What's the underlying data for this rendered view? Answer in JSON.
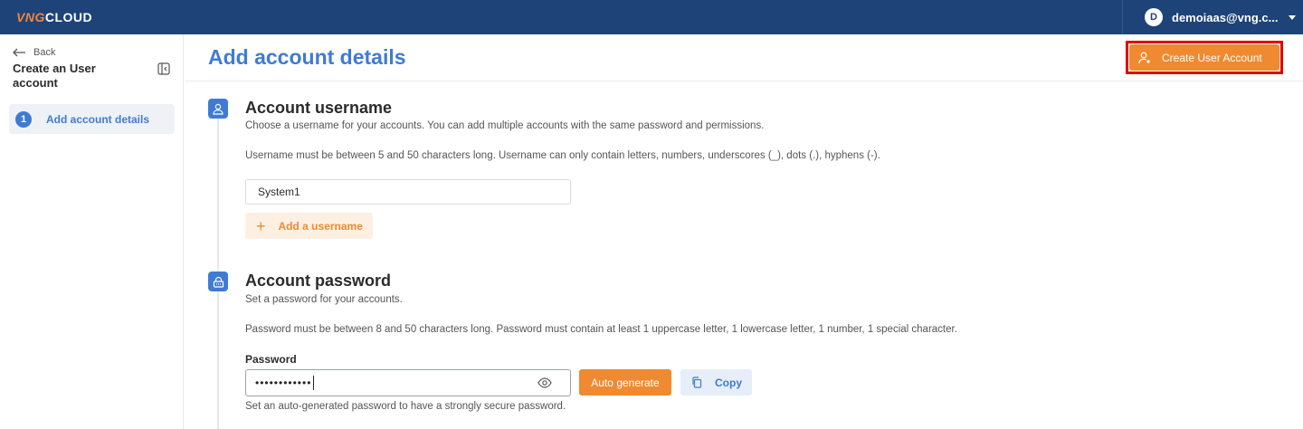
{
  "topbar": {
    "logo_part1": "VNG",
    "logo_part2": "CLOUD",
    "user_initial": "D",
    "user_email": "demoiaas@vng.c..."
  },
  "sidebar": {
    "back_label": "Back",
    "title": "Create an User account",
    "steps": [
      {
        "number": "1",
        "label": "Add account details"
      }
    ]
  },
  "main": {
    "page_title": "Add account details",
    "create_button_label": "Create User Account",
    "username_section": {
      "title": "Account username",
      "description": "Choose a username for your accounts. You can add multiple accounts with the same password and permissions.",
      "rule": "Username must be between 5 and 50 characters long. Username can only contain letters, numbers, underscores (_), dots (.), hyphens (-).",
      "input_value": "System1",
      "add_button_label": "Add a username"
    },
    "password_section": {
      "title": "Account password",
      "description": "Set a password for your accounts.",
      "rule": "Password must be between 8 and 50 characters long. Password must contain at least 1 uppercase letter, 1 lowercase letter, 1 number, 1 special character.",
      "field_label": "Password",
      "masked_value": "••••••••••••",
      "auto_generate_label": "Auto generate",
      "copy_label": "Copy",
      "hint": "Set an auto-generated password to have a strongly secure password."
    }
  },
  "colors": {
    "topbar": "#1d4379",
    "accent_blue": "#3f7bd4",
    "accent_orange": "#f08a30",
    "highlight_red": "#e00000"
  }
}
